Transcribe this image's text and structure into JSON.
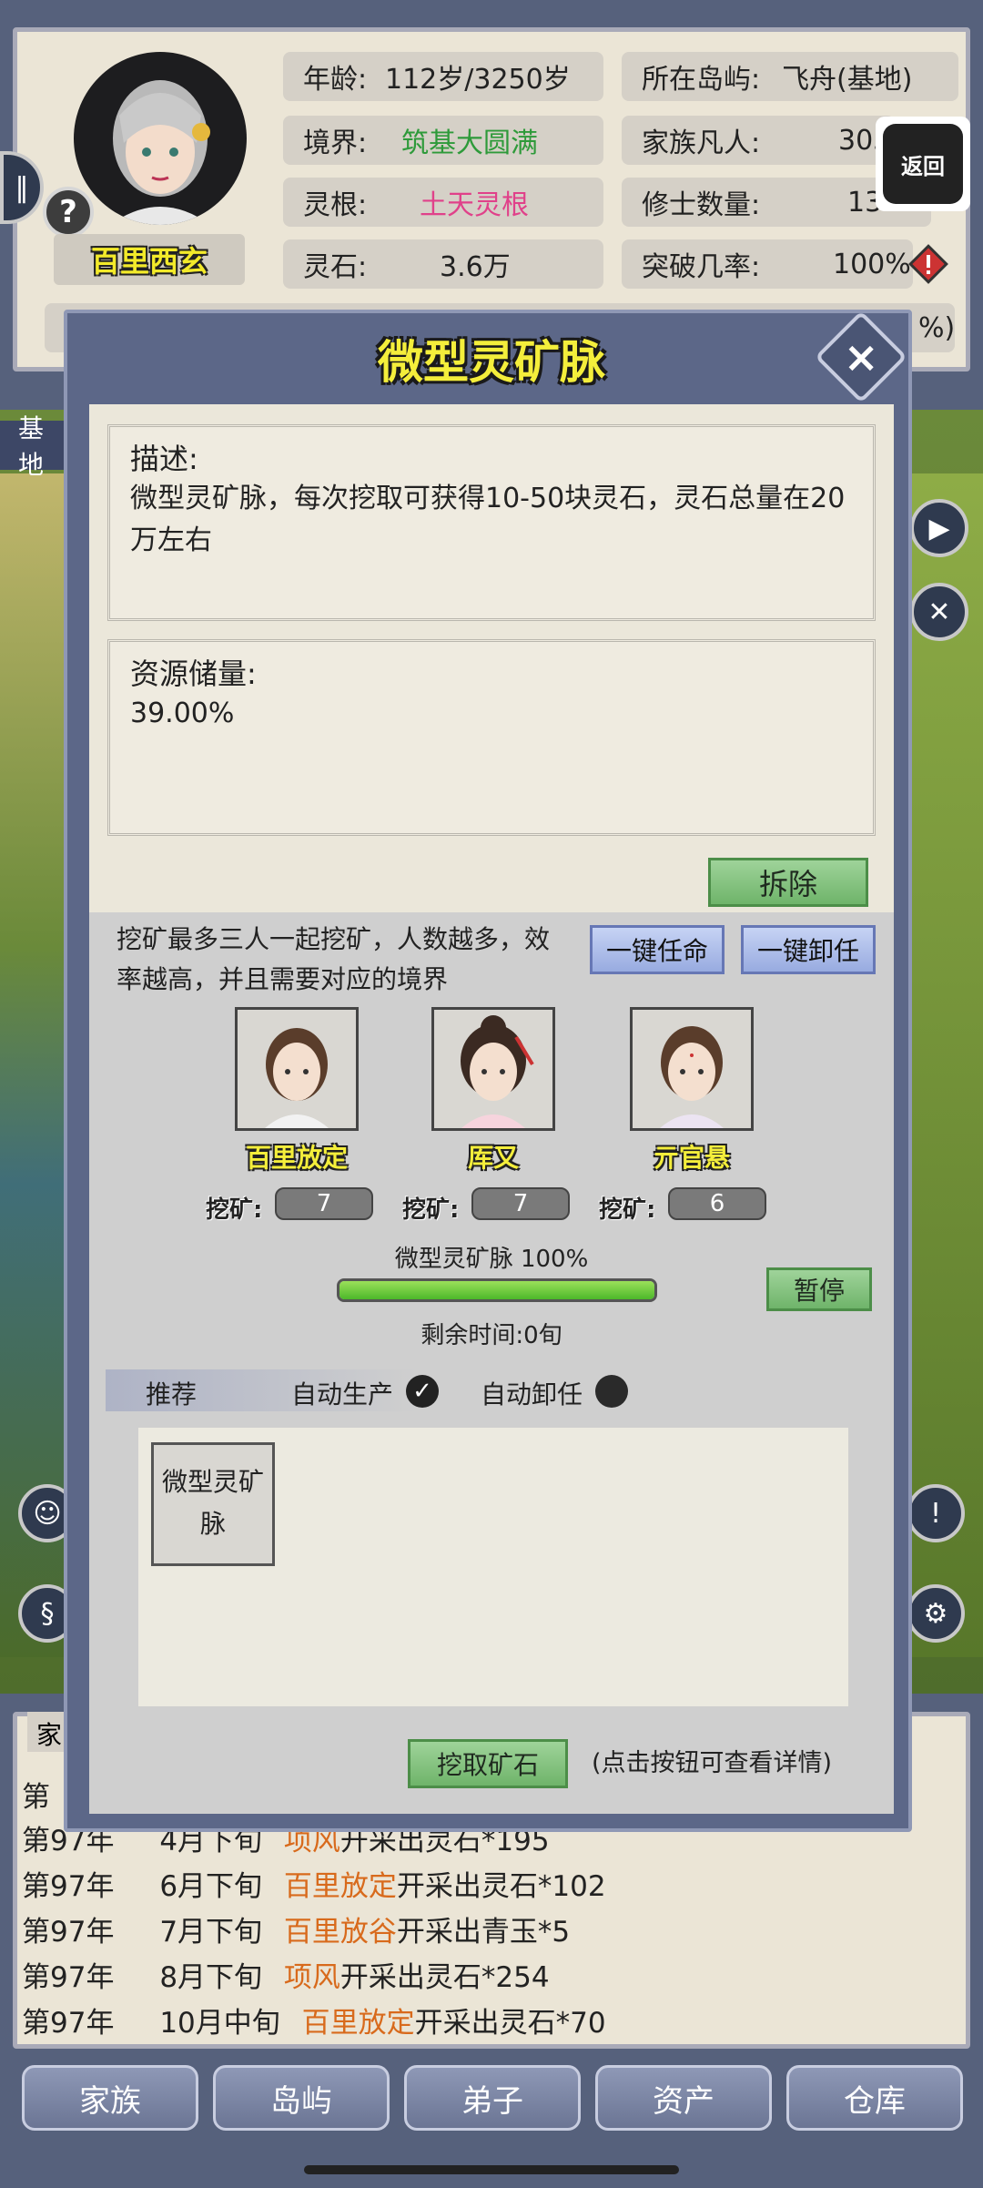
{
  "header": {
    "name": "百里西玄",
    "help_icon": "?",
    "age_label": "年龄:",
    "age_value": "112岁/3250岁",
    "realm_label": "境界:",
    "realm_value": "筑基大圆满",
    "realm_color": "#2e9a3a",
    "root_label": "灵根:",
    "root_value": "土天灵根",
    "root_color": "#e0418a",
    "stones_label": "灵石:",
    "stones_value": "3.6万",
    "island_label": "所在岛屿:",
    "island_value": "飞舟(基地)",
    "mortals_label": "家族凡人:",
    "mortals_value": "303",
    "cultivators_label": "修士数量:",
    "cultivators_value": "13",
    "breakthrough_label": "突破几率:",
    "breakthrough_value": "100%",
    "partial_value": "%)",
    "back_label": "返回"
  },
  "scene": {
    "base_tab": "基地",
    "family_tab": "家"
  },
  "modal": {
    "title": "微型灵矿脉",
    "close_icon": "×",
    "desc_label": "描述:",
    "desc_text": "微型灵矿脉，每次挖取可获得10-50块灵石，灵石总量在20万左右",
    "reserve_label": "资源储量:",
    "reserve_value": "39.00%",
    "demolish_label": "拆除",
    "mine_desc": "挖矿最多三人一起挖矿，人数越多，效率越高，并且需要对应的境界",
    "assign_all_label": "一键任命",
    "unassign_all_label": "一键卸任",
    "workers": [
      {
        "name": "百里放定",
        "mine_label": "挖矿:",
        "mine_value": "7"
      },
      {
        "name": "厍又",
        "mine_label": "挖矿:",
        "mine_value": "7"
      },
      {
        "name": "亓官悬",
        "mine_label": "挖矿:",
        "mine_value": "6"
      }
    ],
    "progress_label": "微型灵矿脉 100%",
    "progress": 1.0,
    "pause_label": "暂停",
    "remaining_label": "剩余时间:0旬",
    "recommend_label": "推荐",
    "auto_produce_label": "自动生产",
    "auto_produce_checked": true,
    "auto_unassign_label": "自动卸任",
    "auto_unassign_checked": false,
    "rec_item_label": "微型灵矿脉",
    "dig_button_label": "挖取矿石",
    "dig_hint": "(点击按钮可查看详情)"
  },
  "log": [
    {
      "year": "第97年",
      "time": "4月下旬",
      "who": "项风",
      "what": "开采出灵石*195"
    },
    {
      "year": "第97年",
      "time": "6月下旬",
      "who": "百里放定",
      "what": "开采出灵石*102"
    },
    {
      "year": "第97年",
      "time": "7月下旬",
      "who": "百里放谷",
      "what": "开采出青玉*5"
    },
    {
      "year": "第97年",
      "time": "8月下旬",
      "who": "项风",
      "what": "开采出灵石*254"
    },
    {
      "year": "第97年",
      "time": "10月中旬",
      "who": "百里放定",
      "what": "开采出灵石*70"
    }
  ],
  "log_partial_year": "第",
  "nav": [
    "家族",
    "岛屿",
    "弟子",
    "资产",
    "仓库"
  ]
}
